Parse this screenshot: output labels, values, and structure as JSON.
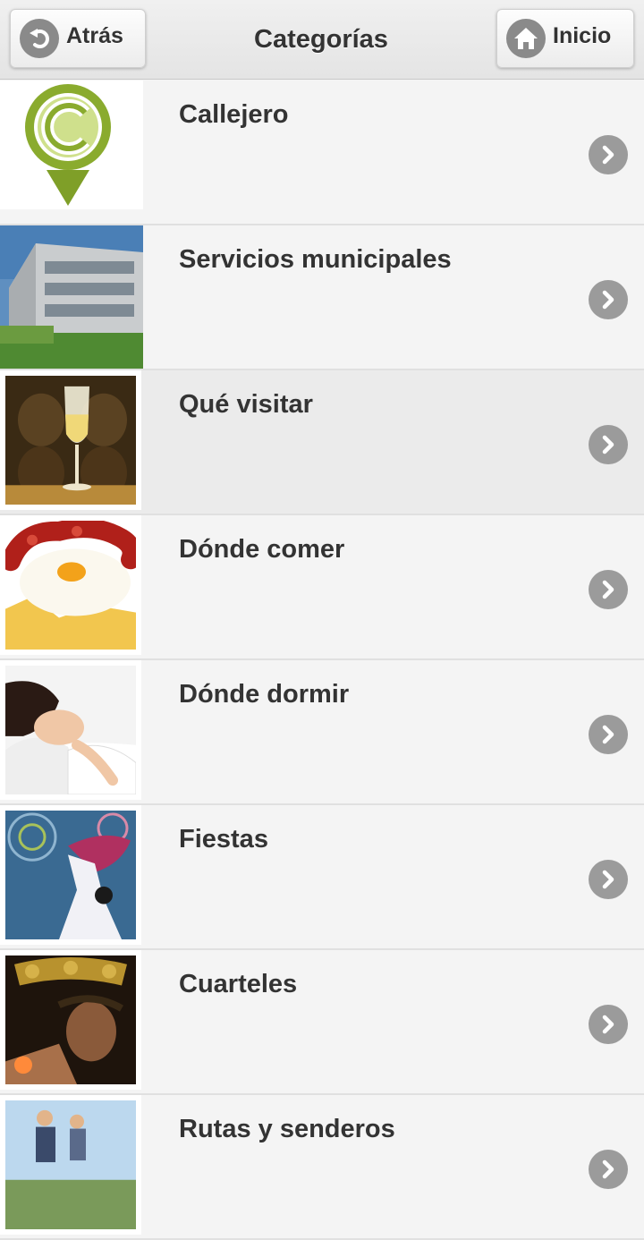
{
  "header": {
    "title": "Categorías",
    "back_label": "Atrás",
    "home_label": "Inicio"
  },
  "categories": [
    {
      "label": "Callejero",
      "image": "callejero-logo"
    },
    {
      "label": "Servicios municipales",
      "image": "municipal-building"
    },
    {
      "label": "Qué visitar",
      "image": "sherry-wine-glass"
    },
    {
      "label": "Dónde comer",
      "image": "fried-egg-chorizo"
    },
    {
      "label": "Dónde dormir",
      "image": "sleeping-woman"
    },
    {
      "label": "Fiestas",
      "image": "flamenco-dancer"
    },
    {
      "label": "Cuarteles",
      "image": "holy-week-christ"
    },
    {
      "label": "Rutas y senderos",
      "image": "hikers"
    }
  ],
  "colors": {
    "background": "#f4f4f4",
    "active_row": "#ebebeb",
    "text": "#333333",
    "arrow_circle": "#9b9b9b",
    "logo_green": "#8aab2e"
  }
}
